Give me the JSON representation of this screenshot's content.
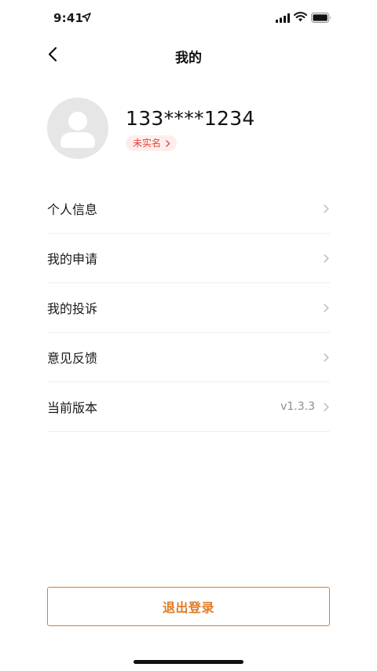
{
  "status_bar": {
    "time": "9:41"
  },
  "nav": {
    "title": "我的"
  },
  "profile": {
    "phone": "133****1234",
    "verify_label": "未实名"
  },
  "menu": {
    "items": [
      {
        "label": "个人信息",
        "value": ""
      },
      {
        "label": "我的申请",
        "value": ""
      },
      {
        "label": "我的投诉",
        "value": ""
      },
      {
        "label": "意见反馈",
        "value": ""
      },
      {
        "label": "当前版本",
        "value": "v1.3.3"
      }
    ]
  },
  "logout": {
    "label": "退出登录"
  },
  "colors": {
    "accent": "#e07b25",
    "badge_text": "#e2463c",
    "badge_bg": "#fdeeee",
    "divider": "#eeeeee",
    "avatar_bg": "#e6e6e6"
  },
  "icons": [
    "location-arrow-icon",
    "signal-icon",
    "wifi-icon",
    "battery-icon",
    "back-chevron-icon",
    "person-icon",
    "chevron-right-icon"
  ]
}
